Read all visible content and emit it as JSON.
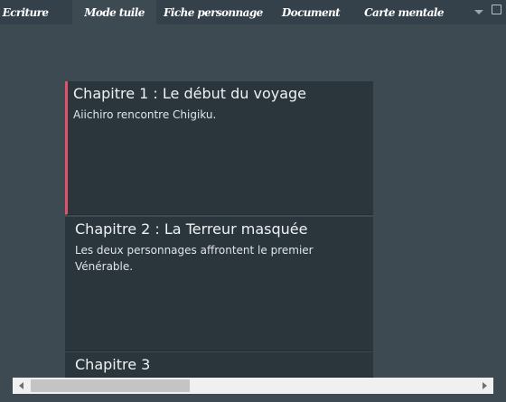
{
  "tabs": [
    {
      "label": "Ecriture",
      "active": false
    },
    {
      "label": "Mode tuile",
      "active": true
    },
    {
      "label": "Fiche personnage",
      "active": false
    },
    {
      "label": "Document",
      "active": false
    },
    {
      "label": "Carte mentale",
      "active": false
    }
  ],
  "tab_menu_icon": "chevron-down-icon",
  "window_icon": "maximize-icon",
  "tiles": [
    {
      "title": "Chapitre 1 : Le début du voyage",
      "summary": "Aiichiro rencontre Chigiku.",
      "selected": true
    },
    {
      "title": "Chapitre 2 : La Terreur masquée",
      "summary": "Les deux personnages affrontent le premier Vénérable.",
      "selected": false
    },
    {
      "title": "Chapitre 3",
      "summary": "",
      "selected": false
    }
  ],
  "colors": {
    "background": "#3e4a52",
    "tile_background": "#2b353c",
    "selection_accent": "#e0526a",
    "tab_bar": "#34404a"
  }
}
